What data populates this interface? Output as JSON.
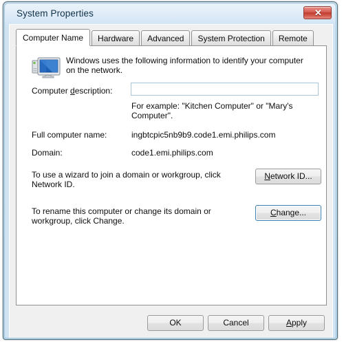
{
  "window": {
    "title": "System Properties",
    "close_label": "✕",
    "frame_color": "#cfe3f3",
    "close_color": "#c0392b"
  },
  "tabs": [
    {
      "label": "Computer Name",
      "active": true
    },
    {
      "label": "Hardware",
      "active": false
    },
    {
      "label": "Advanced",
      "active": false
    },
    {
      "label": "System Protection",
      "active": false
    },
    {
      "label": "Remote",
      "active": false
    }
  ],
  "page": {
    "icon_name": "computer-icon",
    "intro_text": "Windows uses the following information to identify your computer on the network.",
    "description_label_pre": "Computer ",
    "description_label_accel": "d",
    "description_label_post": "escription:",
    "description_value": "",
    "description_placeholder": "",
    "example_text": "For example: \"Kitchen Computer\" or \"Mary's Computer\".",
    "full_computer_name_label": "Full computer name:",
    "full_computer_name_value": "ingbtcpic5nb9b9.code1.emi.philips.com",
    "domain_label": "Domain:",
    "domain_value": "code1.emi.philips.com",
    "wizard_text": "To use a wizard to join a domain or workgroup, click Network ID.",
    "network_id_button_accel": "N",
    "network_id_button_rest": "etwork ID...",
    "rename_text": "To rename this computer or change its domain or workgroup, click Change.",
    "change_button_accel": "C",
    "change_button_rest": "hange..."
  },
  "footer": {
    "ok_label": "OK",
    "cancel_label": "Cancel",
    "apply_accel": "A",
    "apply_rest": "pply"
  }
}
